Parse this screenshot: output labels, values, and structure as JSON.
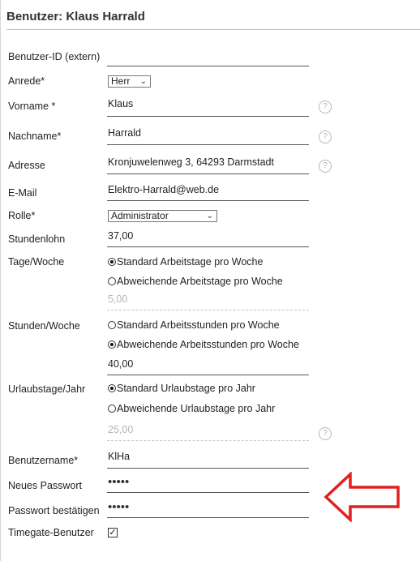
{
  "title": "Benutzer: Klaus Harrald",
  "fields": {
    "benutzer_id": {
      "label": "Benutzer-ID (extern)",
      "value": ""
    },
    "anrede": {
      "label": "Anrede*",
      "value": "Herr"
    },
    "vorname": {
      "label": "Vorname *",
      "value": "Klaus"
    },
    "nachname": {
      "label": "Nachname*",
      "value": "Harrald"
    },
    "adresse": {
      "label": "Adresse",
      "value": "Kronjuwelenweg 3, 64293 Darmstadt"
    },
    "email": {
      "label": "E-Mail",
      "value": "Elektro-Harrald@web.de"
    },
    "rolle": {
      "label": "Rolle*",
      "value": "Administrator"
    },
    "stundenlohn": {
      "label": "Stundenlohn",
      "value": "37,00"
    },
    "tage_woche": {
      "label": "Tage/Woche",
      "option_standard": "Standard Arbeitstage pro Woche",
      "option_abweichend": "Abweichende Arbeitstage pro Woche",
      "selected": "standard",
      "value": "5,00"
    },
    "stunden_woche": {
      "label": "Stunden/Woche",
      "option_standard": "Standard Arbeitsstunden pro Woche",
      "option_abweichend": "Abweichende Arbeitsstunden pro Woche",
      "selected": "abweichend",
      "value": "40,00"
    },
    "urlaubstage": {
      "label": "Urlaubstage/Jahr",
      "option_standard": "Standard Urlaubstage pro Jahr",
      "option_abweichend": "Abweichende Urlaubstage pro Jahr",
      "selected": "standard",
      "value": "25,00"
    },
    "benutzername": {
      "label": "Benutzername*",
      "value": "KlHa"
    },
    "neues_passwort": {
      "label": "Neues Passwort",
      "value": "•••••"
    },
    "passwort_bestaetigen": {
      "label": "Passwort bestätigen",
      "value": "•••••"
    },
    "timegate_benutzer": {
      "label": "Timegate-Benutzer",
      "checked": true
    }
  },
  "help_glyph": "?",
  "chevron_glyph": "⌄",
  "checkmark_glyph": "✓",
  "colors": {
    "title_rule": "#f0b45a",
    "annotation_arrow": "#e02020"
  }
}
